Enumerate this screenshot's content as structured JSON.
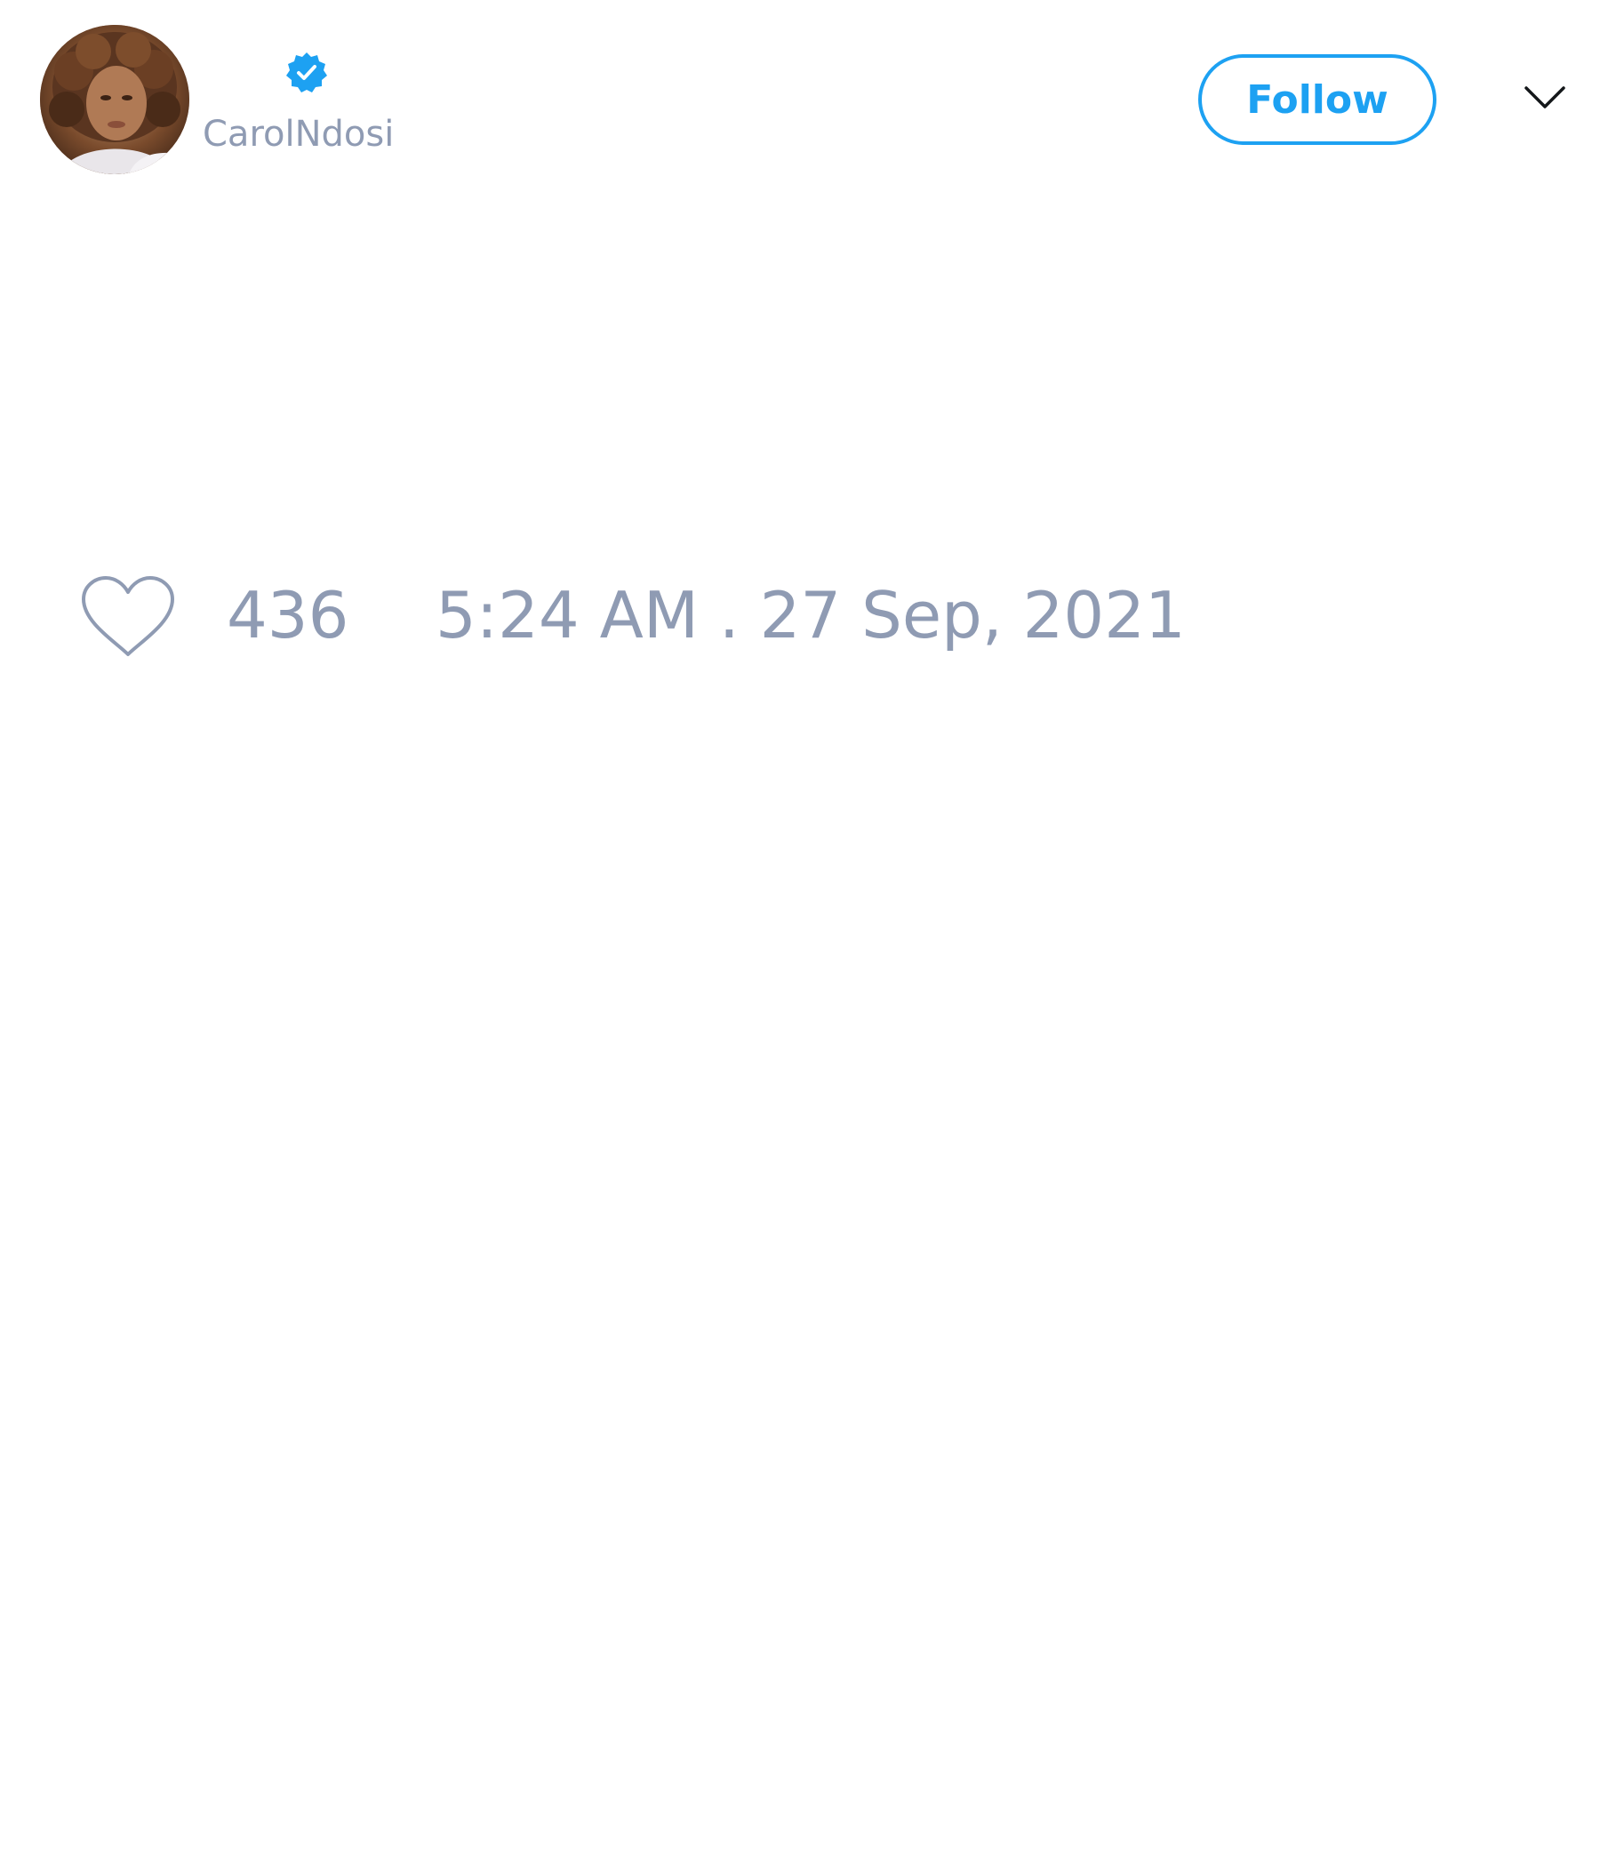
{
  "tweet": {
    "author": {
      "handle": "CarolNdosi",
      "verified": true,
      "avatar_icon": "profile-photo",
      "verified_icon": "verified-badge-icon"
    },
    "follow_label": "Follow",
    "menu_icon": "chevron-down-icon",
    "likes": "436",
    "like_icon": "heart-icon",
    "timestamp": "5:24 AM . 27 Sep, 2021"
  },
  "colors": {
    "accent": "#1da1f2",
    "muted_text": "#8f9bb3",
    "background": "#ffffff"
  }
}
